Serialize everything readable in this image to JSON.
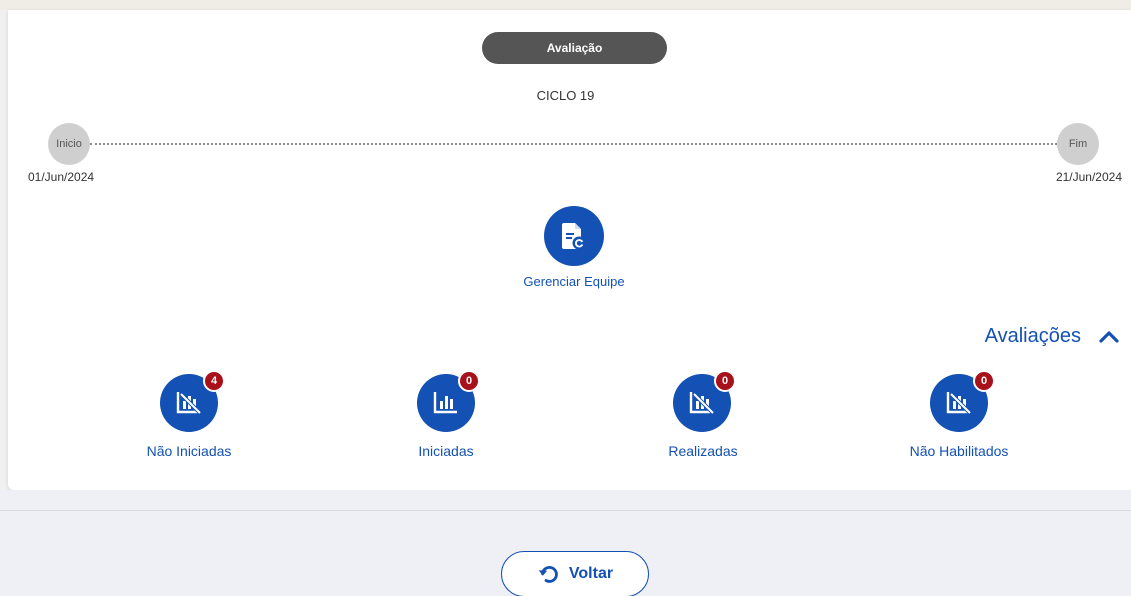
{
  "phase": {
    "label": "Avaliação"
  },
  "cycle": {
    "label": "CICLO 19"
  },
  "timeline": {
    "start_label": "Inicio",
    "end_label": "Fim",
    "start_date": "01/Jun/2024",
    "end_date": "21/Jun/2024"
  },
  "manage": {
    "label": "Gerenciar Equipe",
    "icon": "file-refresh-icon"
  },
  "evaluations": {
    "title": "Avaliações",
    "items": [
      {
        "label": "Não Iniciadas",
        "count": "4",
        "icon": "chart-off-icon"
      },
      {
        "label": "Iniciadas",
        "count": "0",
        "icon": "bar-chart-icon"
      },
      {
        "label": "Realizadas",
        "count": "0",
        "icon": "chart-off-icon"
      },
      {
        "label": "Não Habilitados",
        "count": "0",
        "icon": "chart-off-icon"
      }
    ]
  },
  "back_button": {
    "label": "Voltar",
    "icon": "undo-icon"
  },
  "colors": {
    "primary": "#1351b4",
    "badge": "#a8101a",
    "pill": "#555555"
  }
}
